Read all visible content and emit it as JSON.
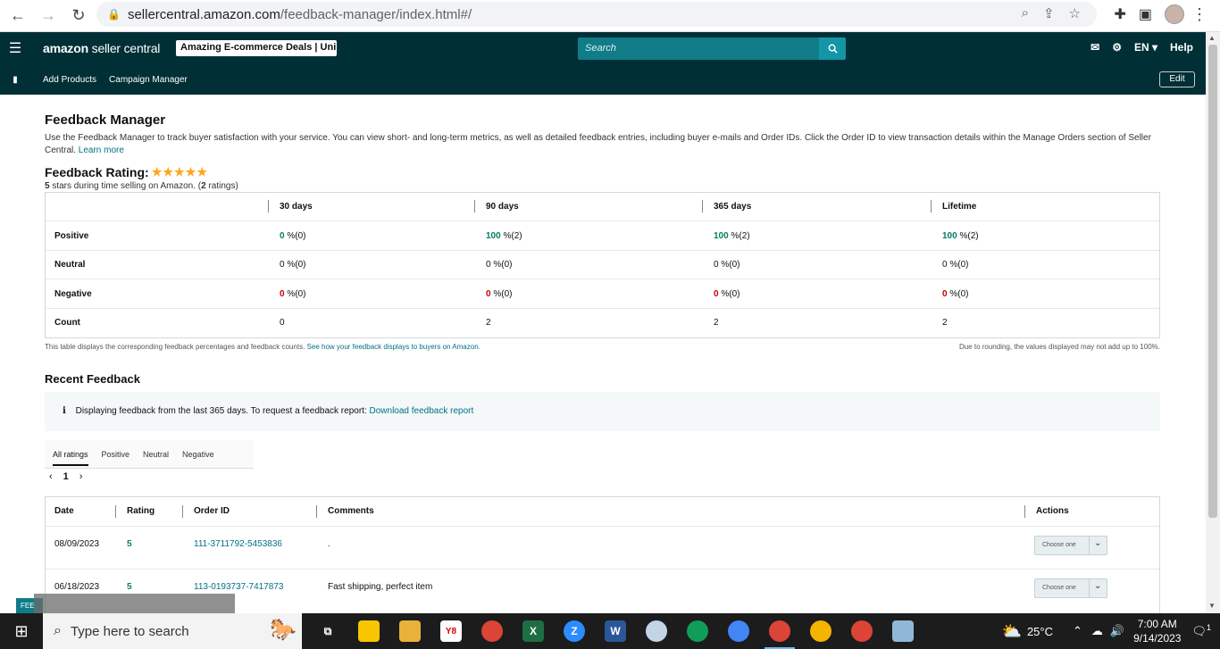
{
  "browser": {
    "domain": "sellercentral.amazon.com",
    "path": "/feedback-manager/index.html#/"
  },
  "header": {
    "logo_bold": "amazon",
    "logo_light": "seller central",
    "store_name": "Amazing E-commerce Deals | Uni...",
    "search_placeholder": "Search",
    "lang": "EN",
    "help": "Help"
  },
  "subnav": {
    "links": [
      "Add Products",
      "Campaign Manager"
    ],
    "edit": "Edit"
  },
  "page": {
    "title": "Feedback Manager",
    "description": "Use the Feedback Manager to track buyer satisfaction with your service. You can view short- and long-term metrics, as well as detailed feedback entries, including buyer e-mails and Order IDs. Click the Order ID to view transaction details within the Manage Orders section of Seller Central.",
    "learn_more": "Learn more",
    "rating_title": "Feedback Rating:",
    "stars": "★★★★★",
    "rating_sub_bold1": "5",
    "rating_sub_mid": "stars during time selling on Amazon. (",
    "rating_sub_bold2": "2",
    "rating_sub_end": "ratings)"
  },
  "feedback_table": {
    "headers": [
      "30 days",
      "90 days",
      "365 days",
      "Lifetime"
    ],
    "rows": [
      {
        "label": "Positive",
        "cells": [
          {
            "v": "0",
            "s": "%(0)"
          },
          {
            "v": "100",
            "s": "%(2)"
          },
          {
            "v": "100",
            "s": "%(2)"
          },
          {
            "v": "100",
            "s": "%(2)"
          }
        ]
      },
      {
        "label": "Neutral",
        "cells": [
          {
            "v": "0",
            "s": "%(0)"
          },
          {
            "v": "0",
            "s": "%(0)"
          },
          {
            "v": "0",
            "s": "%(0)"
          },
          {
            "v": "0",
            "s": "%(0)"
          }
        ]
      },
      {
        "label": "Negative",
        "cells": [
          {
            "v": "0",
            "s": "%(0)"
          },
          {
            "v": "0",
            "s": "%(0)"
          },
          {
            "v": "0",
            "s": "%(0)"
          },
          {
            "v": "0",
            "s": "%(0)"
          }
        ]
      },
      {
        "label": "Count",
        "cells": [
          {
            "v": "0",
            "s": ""
          },
          {
            "v": "2",
            "s": ""
          },
          {
            "v": "2",
            "s": ""
          },
          {
            "v": "2",
            "s": ""
          }
        ]
      }
    ],
    "note_left": "This table displays the corresponding feedback percentages and feedback counts.",
    "note_link": "See how your feedback displays to buyers on Amazon.",
    "note_right": "Due to rounding, the values displayed may not add up to 100%."
  },
  "recent": {
    "title": "Recent Feedback",
    "info_text": "Displaying feedback from the last 365 days. To request a feedback report:",
    "info_link": "Download feedback report",
    "tabs": [
      "All ratings",
      "Positive",
      "Neutral",
      "Negative"
    ],
    "page": "1",
    "columns": [
      "Date",
      "Rating",
      "Order ID",
      "Comments",
      "Actions"
    ],
    "rows": [
      {
        "date": "08/09/2023",
        "rating": "5",
        "order_id": "111-3711792-5453836",
        "comment": ".",
        "action": "Choose one"
      },
      {
        "date": "06/18/2023",
        "rating": "5",
        "order_id": "113-0193737-7417873",
        "comment": "Fast shipping, perfect item",
        "action": "Choose one"
      }
    ]
  },
  "feedback_tab": "FEE",
  "taskbar": {
    "search_placeholder": "Type here to search",
    "temperature": "25°C",
    "time": "7:00 AM",
    "date": "9/14/2023",
    "notification_count": "1"
  }
}
